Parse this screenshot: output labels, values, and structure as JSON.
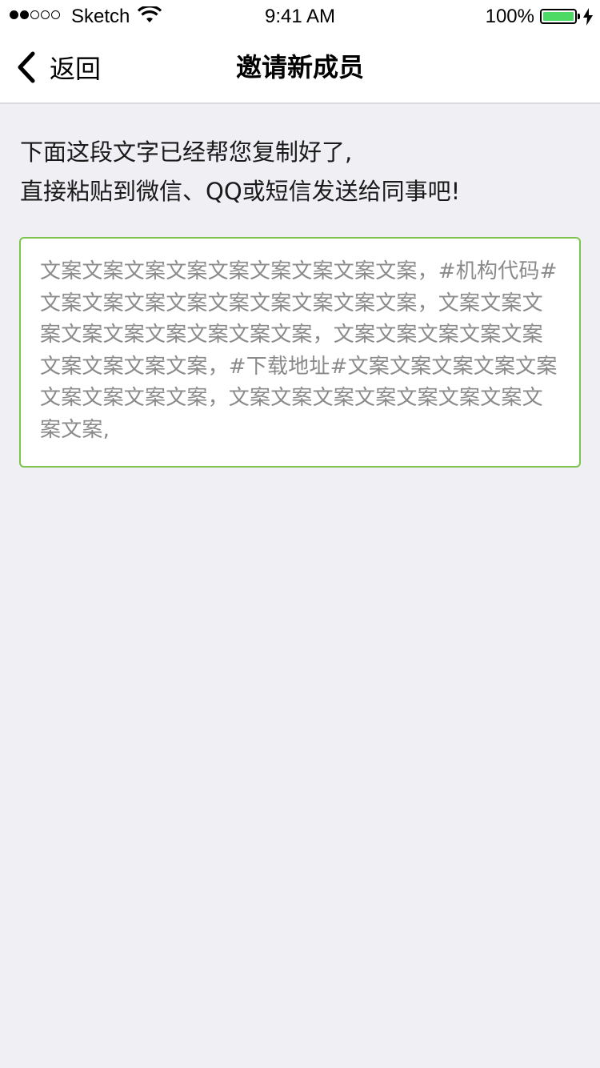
{
  "status_bar": {
    "carrier": "Sketch",
    "time": "9:41 AM",
    "battery_percent": "100%",
    "battery_level": 1.0,
    "signal_strength": 2,
    "signal_total": 5,
    "battery_color": "#4cd964"
  },
  "nav": {
    "back_label": "返回",
    "title": "邀请新成员"
  },
  "instructions": {
    "line1": "下面这段文字已经帮您复制好了,",
    "line2": "直接粘贴到微信、QQ或短信发送给同事吧!"
  },
  "copy_box": {
    "text": "文案文案文案文案文案文案文案文案文案，#机构代码#文案文案文案文案文案文案文案文案文案，文案文案文案文案文案文案文案文案文案，文案文案文案文案文案文案文案文案文案，#下载地址#文案文案文案文案文案文案文案文案文案，文案文案文案文案文案文案文案文案文案,",
    "border_color": "#7cc44e"
  },
  "colors": {
    "background": "#efeff4",
    "nav_background": "#ffffff",
    "placeholder_text": "#8a8a8a"
  }
}
